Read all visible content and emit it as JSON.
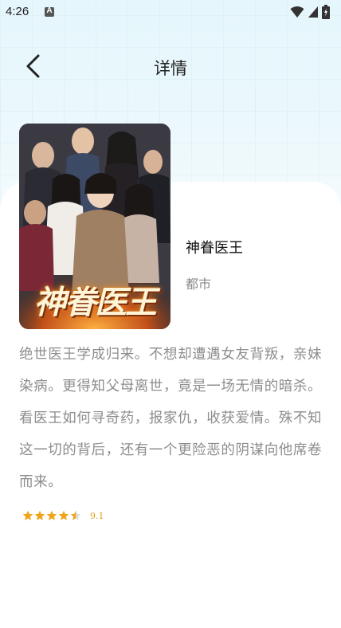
{
  "status_bar": {
    "time": "4:26",
    "notification_letter": "A"
  },
  "header": {
    "back_icon": "chevron-left-icon",
    "title": "详情"
  },
  "drama": {
    "poster_title": "神眷医王",
    "name": "神眷医王",
    "genre": "都市",
    "description": "绝世医王学成归来。不想却遭遇女友背叛，亲妹染病。更得知父母离世，竟是一场无情的暗杀。看医王如何寻奇药，报家仇，收获爱情。殊不知这一切的背后，还有一个更险恶的阴谋向他席卷而来。",
    "rating_stars": 4.5,
    "rating_stars_max": 5,
    "score": "9.1"
  },
  "colors": {
    "star": "#f0a419",
    "score": "#e0a019",
    "description": "#8d8d8d",
    "genre": "#8a8a8a",
    "header_bg": "#e9f7fb"
  }
}
